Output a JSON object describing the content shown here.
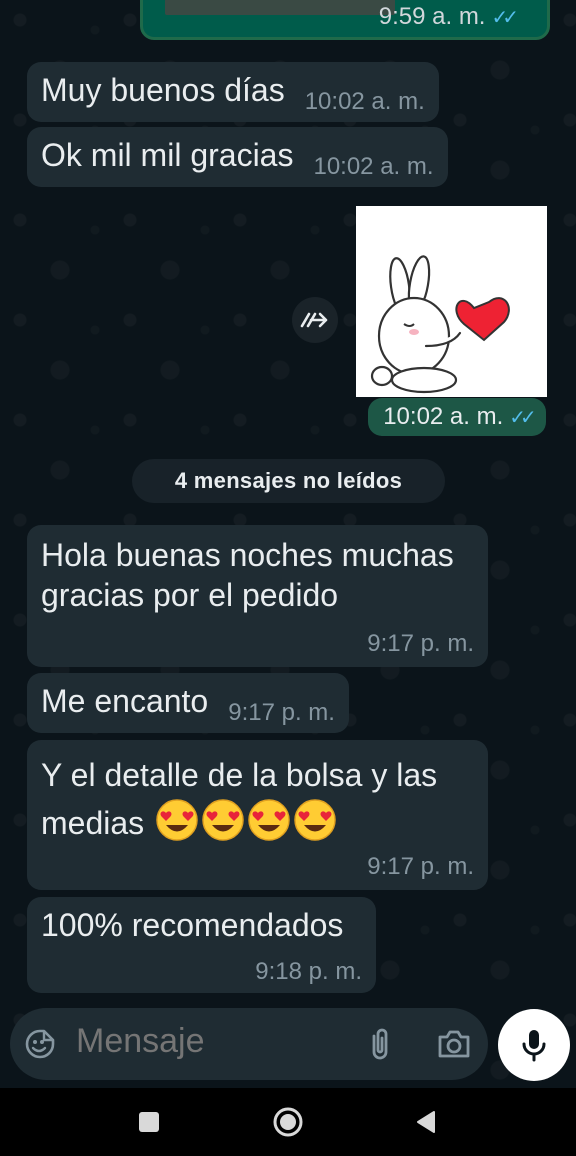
{
  "chat": {
    "top_partial_time": "9:59 a. m.",
    "messages": [
      {
        "text": "Muy buenos días",
        "time": "10:02 a. m."
      },
      {
        "text": "Ok mil mil gracias",
        "time": "10:02 a. m."
      },
      {
        "text": "Hola buenas noches muchas gracias por el pedido",
        "time": "9:17 p. m."
      },
      {
        "text": "Me encanto",
        "time": "9:17 p. m."
      },
      {
        "text": "Y el detalle de la bolsa y las medias",
        "time": "9:17 p. m."
      },
      {
        "text": "100% recomendados",
        "time": "9:18 p. m."
      }
    ],
    "sticker_time": "10:02 a. m.",
    "unread_label": "4 mensajes no leídos"
  },
  "input": {
    "placeholder": "Mensaje"
  },
  "icons": {
    "emoji": "emoji-icon",
    "attach": "paperclip-icon",
    "camera": "camera-icon",
    "mic": "mic-icon",
    "forward": "forward-icon",
    "read": "double-check-icon",
    "nav_recents": "square-icon",
    "nav_home": "circle-icon",
    "nav_back": "triangle-back-icon"
  },
  "colors": {
    "background": "#0b141a",
    "incoming_bubble": "#1f2c33",
    "outgoing_bubble": "#005c4b",
    "read_ticks": "#53bdeb",
    "timestamp": "#8696a0"
  }
}
